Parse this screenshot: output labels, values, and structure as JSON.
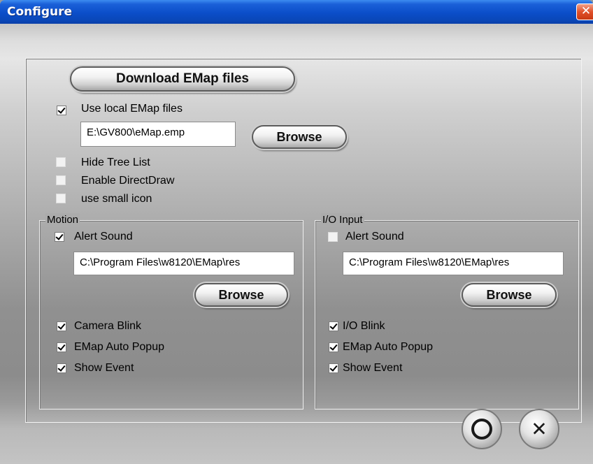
{
  "window": {
    "title": "Configure",
    "close_glyph": "✕"
  },
  "emap": {
    "download_label": "Download EMap files",
    "use_local_label": "Use local EMap files",
    "use_local_checked": true,
    "path": "E:\\GV800\\eMap.emp",
    "browse_label": "Browse"
  },
  "options": [
    {
      "label": "Hide Tree List",
      "checked": false
    },
    {
      "label": "Enable DirectDraw",
      "checked": false
    },
    {
      "label": "use small icon",
      "checked": false
    }
  ],
  "motion": {
    "title": "Motion",
    "alert_sound_label": "Alert Sound",
    "alert_sound_checked": true,
    "path": "C:\\Program Files\\w8120\\EMap\\res",
    "browse_label": "Browse",
    "checks": [
      {
        "label": "Camera Blink",
        "checked": true
      },
      {
        "label": "EMap Auto Popup",
        "checked": true
      },
      {
        "label": "Show Event",
        "checked": true
      }
    ]
  },
  "io_input": {
    "title": "I/O Input",
    "alert_sound_label": "Alert Sound",
    "alert_sound_checked": false,
    "path": "C:\\Program Files\\w8120\\EMap\\res",
    "browse_label": "Browse",
    "checks": [
      {
        "label": "I/O Blink",
        "checked": true
      },
      {
        "label": "EMap Auto Popup",
        "checked": true
      },
      {
        "label": "Show Event",
        "checked": true
      }
    ]
  },
  "footer": {
    "ok_icon": "circle-icon",
    "cancel_icon": "x-icon",
    "cancel_glyph": "✕"
  }
}
